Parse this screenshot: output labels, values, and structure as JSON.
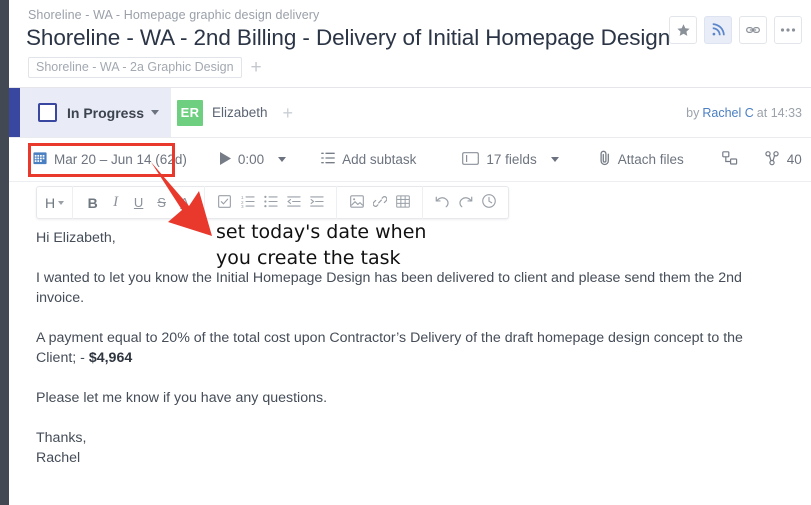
{
  "header": {
    "breadcrumb": "Shoreline - WA - Homepage graphic design delivery",
    "title": "Shoreline - WA  - 2nd Billing - Delivery of Initial Homepage Design",
    "tag": "Shoreline - WA - 2a Graphic Design",
    "tag_add_label": "+",
    "actions": [
      {
        "name": "star-icon",
        "label": "Star"
      },
      {
        "name": "rss-icon",
        "label": "Follow"
      },
      {
        "name": "link-icon",
        "label": "Copy link"
      },
      {
        "name": "more-icon",
        "label": "More"
      }
    ]
  },
  "status": {
    "label": "In Progress",
    "assignee_initials": "ER",
    "assignee_name": "Elizabeth",
    "assignee_add_label": "+",
    "byline_prefix": "by",
    "byline_author": "Rachel C",
    "byline_middle": "at",
    "byline_time": "14:33",
    "accent_color": "#3a47a0",
    "cell_background": "#e9ebf6",
    "avatar_color": "#6fcf80"
  },
  "meta": {
    "date_range": "Mar 20 – Jun 14 (62d)",
    "timer": "0:00",
    "add_subtask": "Add subtask",
    "fields": "17 fields",
    "attach_files": "Attach files",
    "share_count": "40"
  },
  "editor_toolbar": {
    "heading": "H",
    "bold": "B",
    "italic": "I",
    "underline": "U",
    "strikethrough": "S",
    "text_color": "A"
  },
  "document": {
    "greeting": "Hi Elizabeth,",
    "paragraph_1": "I wanted to let you know the Initial Homepage Design has been delivered to client and please send them the 2nd invoice.",
    "paragraph_2_pre": "A payment equal to 20% of the total cost upon Contractor’s Delivery of the draft homepage design concept to the Client; - ",
    "paragraph_2_amount": "$4,964",
    "paragraph_3": "Please let me know if you have any questions.",
    "signoff": "Thanks,",
    "signature": "Rachel"
  },
  "annotation": {
    "text": "set today's date when\nyou create the task",
    "color": "#e8392c"
  }
}
